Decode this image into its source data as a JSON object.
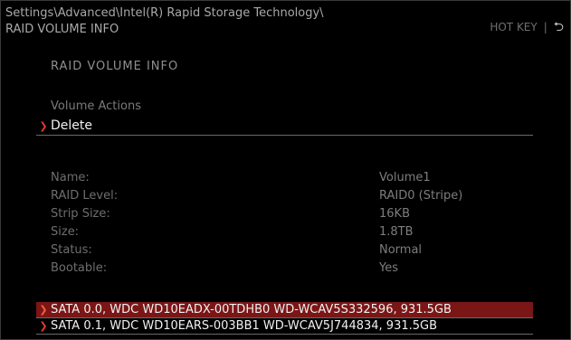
{
  "breadcrumb": {
    "line1": "Settings\\Advanced\\Intel(R) Rapid Storage Technology\\",
    "line2": "RAID VOLUME INFO"
  },
  "header": {
    "hotkey_label": "HOT KEY",
    "separator": "|",
    "back_icon": "back-arrow-icon"
  },
  "page": {
    "title": "RAID VOLUME INFO",
    "actions_label": "Volume Actions",
    "delete_label": "Delete"
  },
  "volume": {
    "rows": [
      {
        "label": "Name:",
        "value": "Volume1"
      },
      {
        "label": "RAID Level:",
        "value": "RAID0 (Stripe)"
      },
      {
        "label": "Strip Size:",
        "value": "16KB"
      },
      {
        "label": "Size:",
        "value": "1.8TB"
      },
      {
        "label": "Status:",
        "value": "Normal"
      },
      {
        "label": "Bootable:",
        "value": "Yes"
      }
    ]
  },
  "disks": [
    {
      "label": "SATA 0.0, WDC WD10EADX-00TDHB0 WD-WCAV5S332596, 931.5GB",
      "selected": true
    },
    {
      "label": "SATA 0.1, WDC WD10EARS-003BB1 WD-WCAV5J744834, 931.5GB",
      "selected": false
    }
  ],
  "colors": {
    "accent_arrow": "#e03a2a",
    "selected_row": "#7a1616",
    "background": "#000000"
  }
}
